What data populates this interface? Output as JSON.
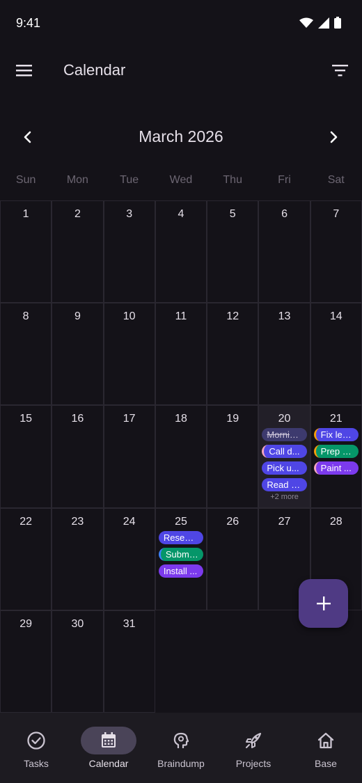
{
  "status_bar": {
    "time": "9:41"
  },
  "app_bar": {
    "title": "Calendar",
    "menu_icon": "menu-icon",
    "filter_icon": "filter-icon"
  },
  "month_nav": {
    "title": "March 2026",
    "prev_icon": "chevron-left-icon",
    "next_icon": "chevron-right-icon"
  },
  "weekdays": [
    "Sun",
    "Mon",
    "Tue",
    "Wed",
    "Thu",
    "Fri",
    "Sat"
  ],
  "calendar": {
    "today": 20,
    "days": [
      {
        "day": "1"
      },
      {
        "day": "2"
      },
      {
        "day": "3"
      },
      {
        "day": "4"
      },
      {
        "day": "5"
      },
      {
        "day": "6"
      },
      {
        "day": "7"
      },
      {
        "day": "8"
      },
      {
        "day": "9"
      },
      {
        "day": "10"
      },
      {
        "day": "11"
      },
      {
        "day": "12"
      },
      {
        "day": "13"
      },
      {
        "day": "14"
      },
      {
        "day": "15"
      },
      {
        "day": "16"
      },
      {
        "day": "17"
      },
      {
        "day": "18"
      },
      {
        "day": "19"
      },
      {
        "day": "20",
        "events": [
          {
            "label": "Mornin...",
            "color": "#3d3a6e",
            "done": true
          },
          {
            "label": "Call d...",
            "color": "#4f46e5",
            "accent": "#f4a6c1"
          },
          {
            "label": "Pick u...",
            "color": "#4f46e5"
          },
          {
            "label": "Read 3...",
            "color": "#4f46e5"
          }
        ],
        "more": "+2 more"
      },
      {
        "day": "21",
        "events": [
          {
            "label": "Fix lea...",
            "color": "#4f46e5",
            "accent": "#f59e0b"
          },
          {
            "label": "Prep s...",
            "color": "#059669",
            "accent": "#f59e0b"
          },
          {
            "label": "Paint ...",
            "color": "#7c3aed",
            "accent": "#f4a6c1"
          }
        ]
      },
      {
        "day": "22"
      },
      {
        "day": "23"
      },
      {
        "day": "24"
      },
      {
        "day": "25",
        "events": [
          {
            "label": "Resear...",
            "color": "#4f46e5"
          },
          {
            "label": "Submi...",
            "color": "#059669",
            "accent": "#3b82f6"
          },
          {
            "label": "Install ...",
            "color": "#7c3aed"
          }
        ]
      },
      {
        "day": "26"
      },
      {
        "day": "27"
      },
      {
        "day": "28"
      },
      {
        "day": "29"
      },
      {
        "day": "30"
      },
      {
        "day": "31"
      }
    ]
  },
  "fab": {
    "icon": "plus-icon"
  },
  "bottom_nav": {
    "items": [
      {
        "label": "Tasks",
        "icon": "check-circle-icon",
        "active": false
      },
      {
        "label": "Calendar",
        "icon": "calendar-icon",
        "active": true
      },
      {
        "label": "Braindump",
        "icon": "brain-icon",
        "active": false
      },
      {
        "label": "Projects",
        "icon": "rocket-icon",
        "active": false
      },
      {
        "label": "Base",
        "icon": "home-icon",
        "active": false
      }
    ]
  },
  "colors": {
    "background": "#141218",
    "surface": "#1d1b21",
    "accent": "#4f3a84",
    "active_pill": "#4a4458"
  }
}
